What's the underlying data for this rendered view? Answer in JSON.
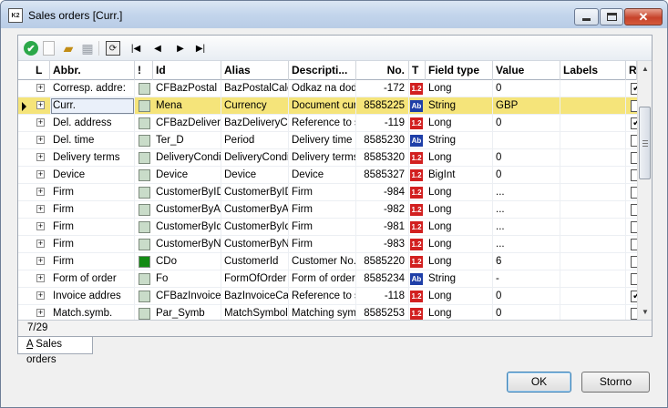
{
  "window": {
    "title": "Sales orders [Curr.]",
    "icon_label": "K2",
    "minimize": "minimize",
    "maximize": "maximize",
    "close": "✕"
  },
  "toolbar": {
    "icons": [
      "confirm-icon",
      "new-icon",
      "open-folder-icon",
      "database-icon",
      "refresh-icon",
      "first-record-icon",
      "previous-record-icon",
      "next-record-icon",
      "last-record-icon"
    ],
    "glyphs": {
      "check": "✔",
      "open": "▰",
      "db": "▦",
      "refresh": "⟳",
      "first": "|◀",
      "prev": "◀",
      "next": "▶",
      "last": "▶|"
    }
  },
  "grid": {
    "columns": [
      "L",
      "Abbr.",
      "!",
      "Id",
      "Alias",
      "Descripti...",
      "No.",
      "T",
      "Field type",
      "Value",
      "Labels",
      "RO"
    ],
    "selected_row_index": 1,
    "rows": [
      {
        "abbr": "Corresp. addre:",
        "color": "#c9dcc9",
        "id": "CFBazPostal",
        "alias": "BazPostalCalc",
        "desc": "Odkaz na doda",
        "no": "-172",
        "type_badge": "1.2",
        "type_color": "#d22020",
        "field_type": "Long",
        "value": "0",
        "labels": "",
        "ro": true
      },
      {
        "abbr": "Curr.",
        "color": "#c9dcc9",
        "id": "Mena",
        "alias": "Currency",
        "desc": "Document curr",
        "no": "8585225",
        "type_badge": "Ab",
        "type_color": "#1f3fa8",
        "field_type": "String",
        "value": "GBP",
        "labels": "",
        "ro": false
      },
      {
        "abbr": "Del. address",
        "color": "#c9dcc9",
        "id": "CFBazDelivery",
        "alias": "BazDeliveryCal",
        "desc": "Reference to s",
        "no": "-119",
        "type_badge": "1.2",
        "type_color": "#d22020",
        "field_type": "Long",
        "value": "0",
        "labels": "",
        "ro": true
      },
      {
        "abbr": "Del. time",
        "color": "#c9dcc9",
        "id": "Ter_D",
        "alias": "Period",
        "desc": "Delivery time",
        "no": "8585230",
        "type_badge": "Ab",
        "type_color": "#1f3fa8",
        "field_type": "String",
        "value": "",
        "labels": "",
        "ro": false
      },
      {
        "abbr": "Delivery terms",
        "color": "#c9dcc9",
        "id": "DeliveryCondic",
        "alias": "DeliveryCondic",
        "desc": "Delivery terms",
        "no": "8585320",
        "type_badge": "1.2",
        "type_color": "#d22020",
        "field_type": "Long",
        "value": "0",
        "labels": "",
        "ro": false
      },
      {
        "abbr": "Device",
        "color": "#c9dcc9",
        "id": "Device",
        "alias": "Device",
        "desc": "Device",
        "no": "8585327",
        "type_badge": "1.2",
        "type_color": "#d22020",
        "field_type": "BigInt",
        "value": "0",
        "labels": "",
        "ro": false
      },
      {
        "abbr": "Firm",
        "color": "#c9dcc9",
        "id": "CustomerByIDN",
        "alias": "CustomerByIDN",
        "desc": "Firm",
        "no": "-984",
        "type_badge": "1.2",
        "type_color": "#d22020",
        "field_type": "Long",
        "value": "...",
        "labels": "",
        "ro": false
      },
      {
        "abbr": "Firm",
        "color": "#c9dcc9",
        "id": "CustomerByAbl",
        "alias": "CustomerByAbl",
        "desc": "Firm",
        "no": "-982",
        "type_badge": "1.2",
        "type_color": "#d22020",
        "field_type": "Long",
        "value": "...",
        "labels": "",
        "ro": false
      },
      {
        "abbr": "Firm",
        "color": "#c9dcc9",
        "id": "CustomerByIdIr",
        "alias": "CustomerByIdIr",
        "desc": "Firm",
        "no": "-981",
        "type_badge": "1.2",
        "type_color": "#d22020",
        "field_type": "Long",
        "value": "...",
        "labels": "",
        "ro": false
      },
      {
        "abbr": "Firm",
        "color": "#c9dcc9",
        "id": "CustomerByNa",
        "alias": "CustomerByNa",
        "desc": "Firm",
        "no": "-983",
        "type_badge": "1.2",
        "type_color": "#d22020",
        "field_type": "Long",
        "value": "...",
        "labels": "",
        "ro": false
      },
      {
        "abbr": "Firm",
        "color": "#138a13",
        "id": "CDo",
        "alias": "CustomerId",
        "desc": "Customer No.",
        "no": "8585220",
        "type_badge": "1.2",
        "type_color": "#d22020",
        "field_type": "Long",
        "value": "6",
        "labels": "",
        "ro": false
      },
      {
        "abbr": "Form of order",
        "color": "#c9dcc9",
        "id": "Fo",
        "alias": "FormOfOrder",
        "desc": "Form of order",
        "no": "8585234",
        "type_badge": "Ab",
        "type_color": "#1f3fa8",
        "field_type": "String",
        "value": "-",
        "labels": "",
        "ro": false
      },
      {
        "abbr": "Invoice addres",
        "color": "#c9dcc9",
        "id": "CFBazInvoice",
        "alias": "BazInvoiceCalc",
        "desc": "Reference to s",
        "no": "-118",
        "type_badge": "1.2",
        "type_color": "#d22020",
        "field_type": "Long",
        "value": "0",
        "labels": "",
        "ro": true
      },
      {
        "abbr": "Match.symb.",
        "color": "#c9dcc9",
        "id": "Par_Symb",
        "alias": "MatchSymbol",
        "desc": "Matching symb",
        "no": "8585253",
        "type_badge": "1.2",
        "type_color": "#d22020",
        "field_type": "Long",
        "value": "0",
        "labels": "",
        "ro": false
      }
    ]
  },
  "status": {
    "record_counter": "7/29"
  },
  "tabs": [
    {
      "hotkey": "A",
      "label": " Sales orders"
    }
  ],
  "buttons": {
    "ok": "OK",
    "cancel": "Storno"
  },
  "ro_check_glyph": "✓",
  "expander_glyph": "+"
}
